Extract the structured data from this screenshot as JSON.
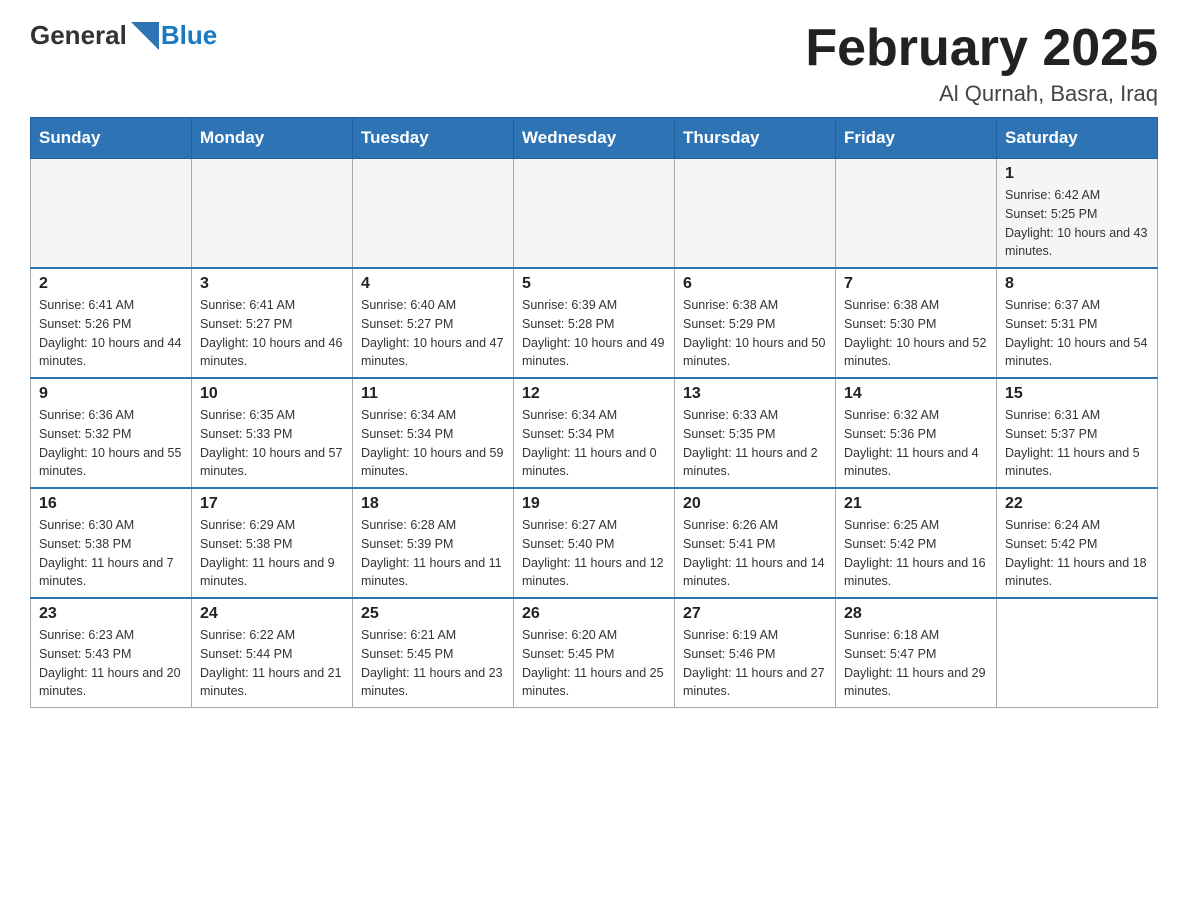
{
  "header": {
    "logo_general": "General",
    "logo_blue": "Blue",
    "month_title": "February 2025",
    "location": "Al Qurnah, Basra, Iraq"
  },
  "weekdays": [
    "Sunday",
    "Monday",
    "Tuesday",
    "Wednesday",
    "Thursday",
    "Friday",
    "Saturday"
  ],
  "weeks": [
    {
      "days": [
        {
          "num": "",
          "info": ""
        },
        {
          "num": "",
          "info": ""
        },
        {
          "num": "",
          "info": ""
        },
        {
          "num": "",
          "info": ""
        },
        {
          "num": "",
          "info": ""
        },
        {
          "num": "",
          "info": ""
        },
        {
          "num": "1",
          "info": "Sunrise: 6:42 AM\nSunset: 5:25 PM\nDaylight: 10 hours and 43 minutes."
        }
      ]
    },
    {
      "days": [
        {
          "num": "2",
          "info": "Sunrise: 6:41 AM\nSunset: 5:26 PM\nDaylight: 10 hours and 44 minutes."
        },
        {
          "num": "3",
          "info": "Sunrise: 6:41 AM\nSunset: 5:27 PM\nDaylight: 10 hours and 46 minutes."
        },
        {
          "num": "4",
          "info": "Sunrise: 6:40 AM\nSunset: 5:27 PM\nDaylight: 10 hours and 47 minutes."
        },
        {
          "num": "5",
          "info": "Sunrise: 6:39 AM\nSunset: 5:28 PM\nDaylight: 10 hours and 49 minutes."
        },
        {
          "num": "6",
          "info": "Sunrise: 6:38 AM\nSunset: 5:29 PM\nDaylight: 10 hours and 50 minutes."
        },
        {
          "num": "7",
          "info": "Sunrise: 6:38 AM\nSunset: 5:30 PM\nDaylight: 10 hours and 52 minutes."
        },
        {
          "num": "8",
          "info": "Sunrise: 6:37 AM\nSunset: 5:31 PM\nDaylight: 10 hours and 54 minutes."
        }
      ]
    },
    {
      "days": [
        {
          "num": "9",
          "info": "Sunrise: 6:36 AM\nSunset: 5:32 PM\nDaylight: 10 hours and 55 minutes."
        },
        {
          "num": "10",
          "info": "Sunrise: 6:35 AM\nSunset: 5:33 PM\nDaylight: 10 hours and 57 minutes."
        },
        {
          "num": "11",
          "info": "Sunrise: 6:34 AM\nSunset: 5:34 PM\nDaylight: 10 hours and 59 minutes."
        },
        {
          "num": "12",
          "info": "Sunrise: 6:34 AM\nSunset: 5:34 PM\nDaylight: 11 hours and 0 minutes."
        },
        {
          "num": "13",
          "info": "Sunrise: 6:33 AM\nSunset: 5:35 PM\nDaylight: 11 hours and 2 minutes."
        },
        {
          "num": "14",
          "info": "Sunrise: 6:32 AM\nSunset: 5:36 PM\nDaylight: 11 hours and 4 minutes."
        },
        {
          "num": "15",
          "info": "Sunrise: 6:31 AM\nSunset: 5:37 PM\nDaylight: 11 hours and 5 minutes."
        }
      ]
    },
    {
      "days": [
        {
          "num": "16",
          "info": "Sunrise: 6:30 AM\nSunset: 5:38 PM\nDaylight: 11 hours and 7 minutes."
        },
        {
          "num": "17",
          "info": "Sunrise: 6:29 AM\nSunset: 5:38 PM\nDaylight: 11 hours and 9 minutes."
        },
        {
          "num": "18",
          "info": "Sunrise: 6:28 AM\nSunset: 5:39 PM\nDaylight: 11 hours and 11 minutes."
        },
        {
          "num": "19",
          "info": "Sunrise: 6:27 AM\nSunset: 5:40 PM\nDaylight: 11 hours and 12 minutes."
        },
        {
          "num": "20",
          "info": "Sunrise: 6:26 AM\nSunset: 5:41 PM\nDaylight: 11 hours and 14 minutes."
        },
        {
          "num": "21",
          "info": "Sunrise: 6:25 AM\nSunset: 5:42 PM\nDaylight: 11 hours and 16 minutes."
        },
        {
          "num": "22",
          "info": "Sunrise: 6:24 AM\nSunset: 5:42 PM\nDaylight: 11 hours and 18 minutes."
        }
      ]
    },
    {
      "days": [
        {
          "num": "23",
          "info": "Sunrise: 6:23 AM\nSunset: 5:43 PM\nDaylight: 11 hours and 20 minutes."
        },
        {
          "num": "24",
          "info": "Sunrise: 6:22 AM\nSunset: 5:44 PM\nDaylight: 11 hours and 21 minutes."
        },
        {
          "num": "25",
          "info": "Sunrise: 6:21 AM\nSunset: 5:45 PM\nDaylight: 11 hours and 23 minutes."
        },
        {
          "num": "26",
          "info": "Sunrise: 6:20 AM\nSunset: 5:45 PM\nDaylight: 11 hours and 25 minutes."
        },
        {
          "num": "27",
          "info": "Sunrise: 6:19 AM\nSunset: 5:46 PM\nDaylight: 11 hours and 27 minutes."
        },
        {
          "num": "28",
          "info": "Sunrise: 6:18 AM\nSunset: 5:47 PM\nDaylight: 11 hours and 29 minutes."
        },
        {
          "num": "",
          "info": ""
        }
      ]
    }
  ]
}
